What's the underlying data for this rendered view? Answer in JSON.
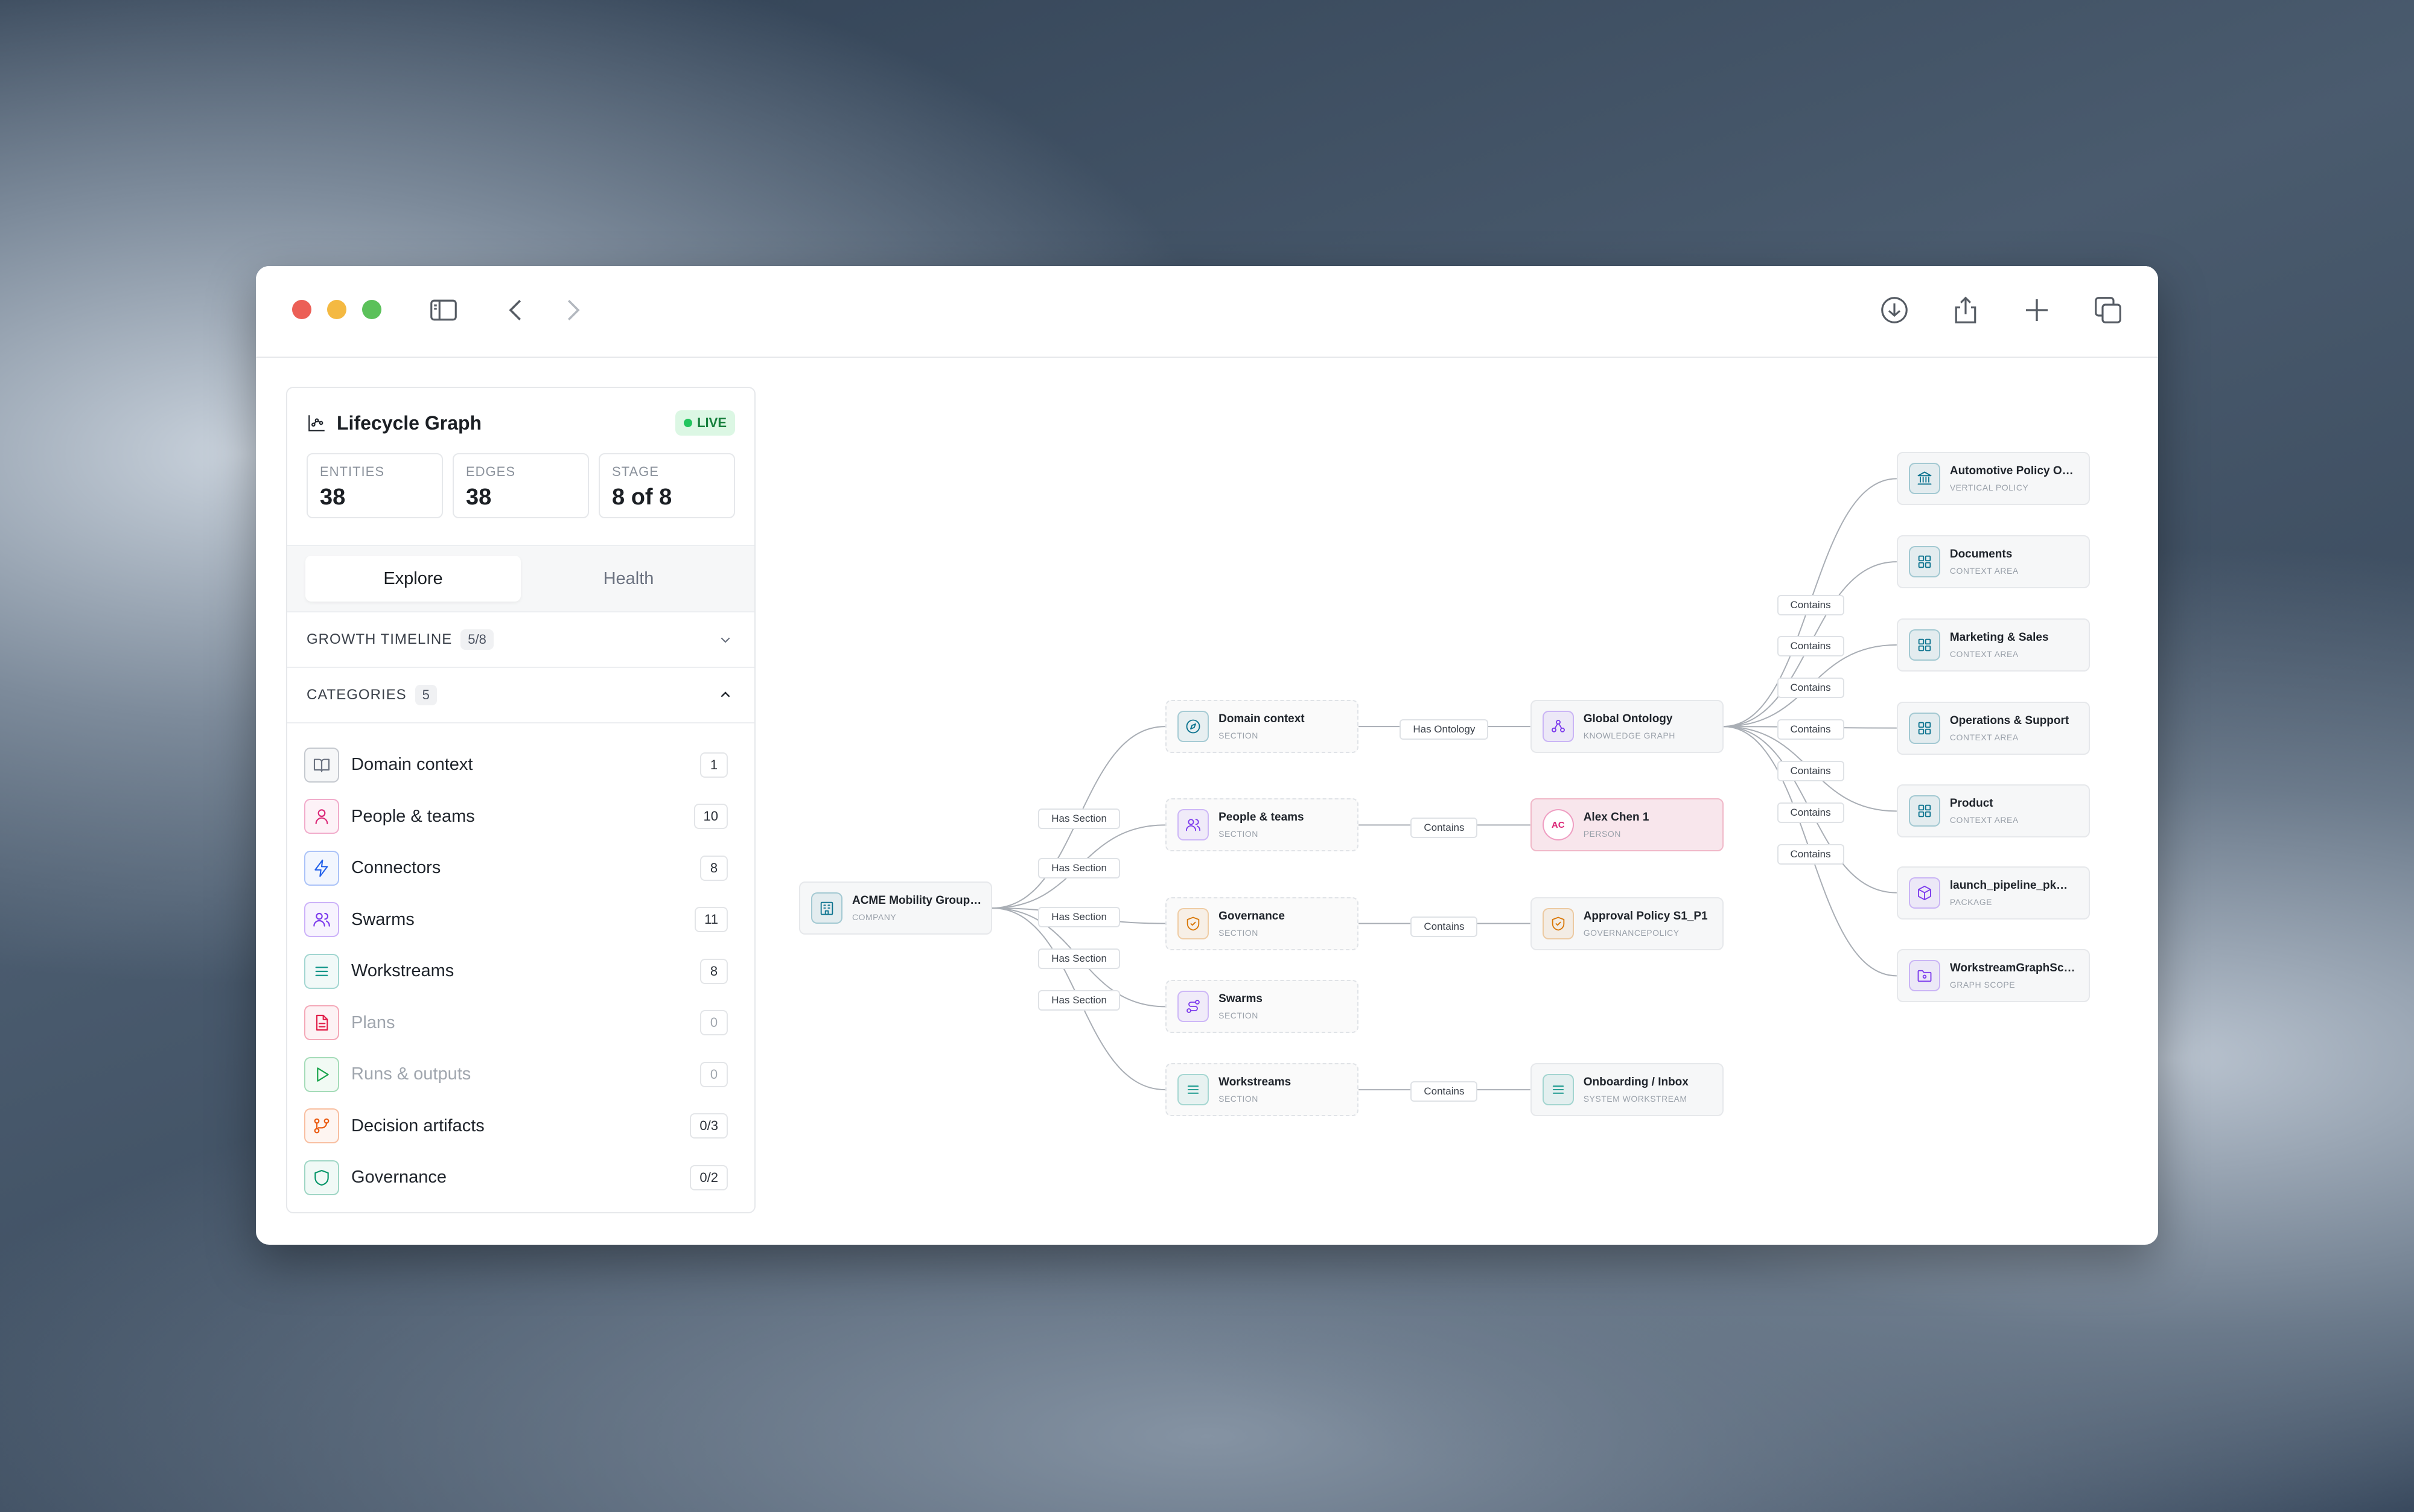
{
  "window": {
    "traffic_colors": [
      "#ec5f56",
      "#f4b942",
      "#5bc15a"
    ]
  },
  "toolbar": {
    "sidebar_icon": "sidebar-toggle-icon",
    "back_icon": "chevron-left-icon",
    "forward_icon": "chevron-right-icon",
    "download_icon": "download-icon",
    "share_icon": "share-icon",
    "new_tab_icon": "plus-icon",
    "tabs_icon": "tabs-overview-icon"
  },
  "panel": {
    "title": "Lifecycle Graph",
    "status": "LIVE",
    "stats": [
      {
        "label": "ENTITIES",
        "value": "38"
      },
      {
        "label": "EDGES",
        "value": "38"
      },
      {
        "label": "STAGE",
        "value": "8 of 8"
      }
    ],
    "tabs": [
      {
        "label": "Explore",
        "active": true
      },
      {
        "label": "Health",
        "active": false
      }
    ],
    "growth": {
      "label": "GROWTH TIMELINE",
      "badge": "5/8"
    },
    "categories_header": {
      "label": "CATEGORIES",
      "badge": "5"
    },
    "categories": [
      {
        "label": "Domain context",
        "count": "1",
        "color": "#6b7280",
        "icon": "book-icon"
      },
      {
        "label": "People & teams",
        "count": "10",
        "color": "#db2777",
        "icon": "person-icon"
      },
      {
        "label": "Connectors",
        "count": "8",
        "color": "#2563eb",
        "icon": "lightning-icon"
      },
      {
        "label": "Swarms",
        "count": "11",
        "color": "#7c3aed",
        "icon": "users-icon"
      },
      {
        "label": "Workstreams",
        "count": "8",
        "color": "#0d9488",
        "icon": "list-icon"
      },
      {
        "label": "Plans",
        "count": "0",
        "color": "#e11d48",
        "icon": "document-icon"
      },
      {
        "label": "Runs & outputs",
        "count": "0",
        "color": "#16a34a",
        "icon": "play-icon"
      },
      {
        "label": "Decision artifacts",
        "count": "0/3",
        "color": "#ea580c",
        "icon": "branch-icon"
      },
      {
        "label": "Governance",
        "count": "0/2",
        "color": "#059669",
        "icon": "shield-icon"
      }
    ]
  },
  "graph": {
    "nodes": [
      {
        "id": "acme",
        "title": "ACME Mobility Group…",
        "sub": "COMPANY",
        "color": "#0e7490"
      },
      {
        "id": "domain",
        "title": "Domain context",
        "sub": "SECTION",
        "color": "#0e7490"
      },
      {
        "id": "people",
        "title": "People & teams",
        "sub": "SECTION",
        "color": "#7c3aed"
      },
      {
        "id": "governance",
        "title": "Governance",
        "sub": "SECTION",
        "color": "#d97706"
      },
      {
        "id": "swarms",
        "title": "Swarms",
        "sub": "SECTION",
        "color": "#7c3aed"
      },
      {
        "id": "workstreams",
        "title": "Workstreams",
        "sub": "SECTION",
        "color": "#0d9488"
      },
      {
        "id": "ontology",
        "title": "Global Ontology",
        "sub": "KNOWLEDGE GRAPH",
        "color": "#7c3aed"
      },
      {
        "id": "alex",
        "title": "Alex Chen 1",
        "sub": "PERSON",
        "color": "#db2777",
        "initials": "AC"
      },
      {
        "id": "approval",
        "title": "Approval Policy S1_P1",
        "sub": "GOVERNANCEPOLICY",
        "color": "#d97706"
      },
      {
        "id": "onboarding",
        "title": "Onboarding / Inbox",
        "sub": "SYSTEM WORKSTREAM",
        "color": "#0d9488"
      },
      {
        "id": "automotive",
        "title": "Automotive Policy O…",
        "sub": "VERTICAL POLICY",
        "color": "#0e7490"
      },
      {
        "id": "documents",
        "title": "Documents",
        "sub": "CONTEXT AREA",
        "color": "#0e7490"
      },
      {
        "id": "marketing",
        "title": "Marketing & Sales",
        "sub": "CONTEXT AREA",
        "color": "#0e7490"
      },
      {
        "id": "operations",
        "title": "Operations & Support",
        "sub": "CONTEXT AREA",
        "color": "#0e7490"
      },
      {
        "id": "product",
        "title": "Product",
        "sub": "CONTEXT AREA",
        "color": "#0e7490"
      },
      {
        "id": "launch",
        "title": "launch_pipeline_pk…",
        "sub": "PACKAGE",
        "color": "#7c3aed"
      },
      {
        "id": "wsgraph",
        "title": "WorkstreamGraphSc…",
        "sub": "GRAPH SCOPE",
        "color": "#7c3aed"
      }
    ],
    "edge_labels": {
      "has_section": "Has Section",
      "has_ontology": "Has Ontology",
      "contains": "Contains"
    }
  }
}
